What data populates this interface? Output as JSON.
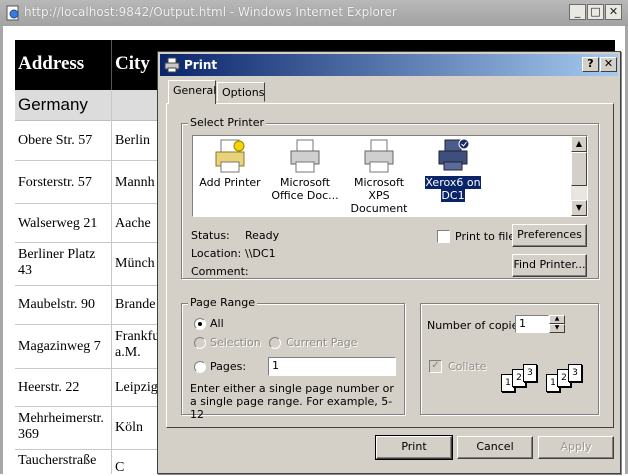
{
  "window": {
    "title": "http://localhost:9842/Output.html - Windows Internet Explorer",
    "min_label": "_",
    "max_label": "□",
    "close_label": "✕"
  },
  "table": {
    "headers": [
      "Address",
      "City"
    ],
    "group": "Germany",
    "rows": [
      {
        "address": "Obere Str. 57",
        "city": "Berlin"
      },
      {
        "address": "Forsterstr. 57",
        "city": "Mannh"
      },
      {
        "address": "Walserweg 21",
        "city": "Aache"
      },
      {
        "address": "Berliner Platz 43",
        "city": "Münch"
      },
      {
        "address": "Maubelstr. 90",
        "city": "Brande"
      },
      {
        "address": "Magazinweg 7",
        "city": "Frankfu a.M."
      },
      {
        "address": "Heerstr. 22",
        "city": "Leipzig"
      },
      {
        "address": "Mehrheimerstr. 369",
        "city": "Köln"
      },
      {
        "address": "Taucherstraße",
        "city": "C"
      }
    ]
  },
  "dialog": {
    "title": "Print",
    "help_label": "?",
    "close_label": "✕",
    "tabs": [
      {
        "label": "General"
      },
      {
        "label": "Options"
      }
    ],
    "select_printer_label": "Select Printer",
    "printers": [
      {
        "label": "Add Printer"
      },
      {
        "label": "Microsoft Office Doc..."
      },
      {
        "label": "Microsoft XPS Document ..."
      },
      {
        "label": "Xerox6 on DC1"
      }
    ],
    "status_label": "Status:",
    "status_value": "Ready",
    "location_label": "Location:",
    "location_value": "\\\\DC1",
    "comment_label": "Comment:",
    "print_to_file_label": "Print to file",
    "preferences_label": "Preferences",
    "find_printer_label": "Find Printer...",
    "page_range_label": "Page Range",
    "all_label": "All",
    "selection_label": "Selection",
    "current_page_label": "Current Page",
    "pages_label": "Pages:",
    "pages_value": "1",
    "hint": "Enter either a single page number or a single page range.  For example, 5-12",
    "copies_label": "Number of copies:",
    "copies_value": "1",
    "collate_label": "Collate",
    "print_label": "Print",
    "cancel_label": "Cancel",
    "apply_label": "Apply",
    "page_numbers": [
      "1",
      "2",
      "3"
    ]
  }
}
